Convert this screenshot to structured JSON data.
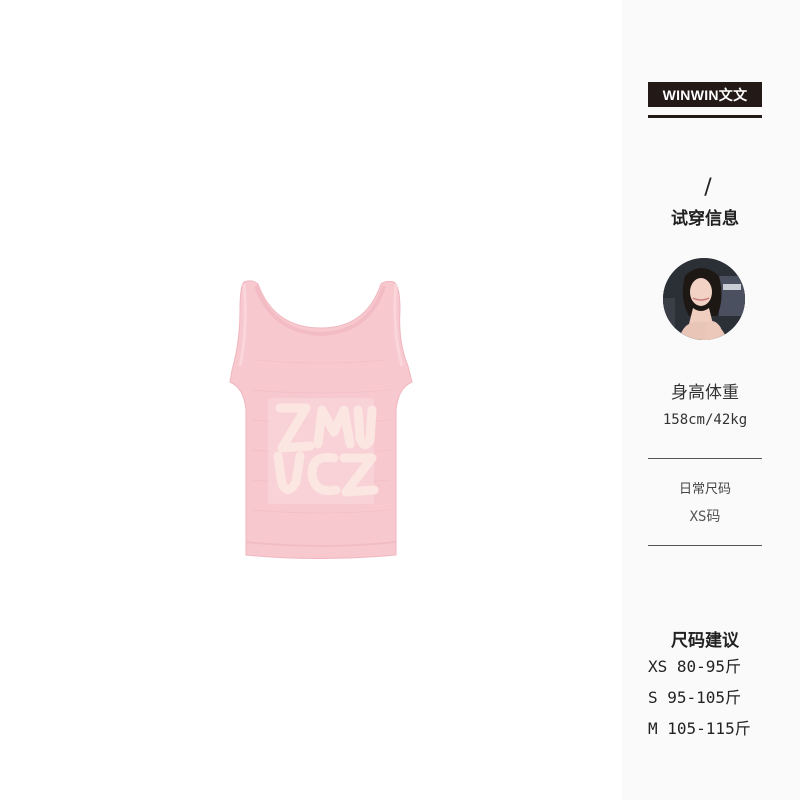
{
  "brand": {
    "name": "WINWIN文文"
  },
  "tryon": {
    "slash": "/",
    "title": "试穿信息",
    "height_weight_label": "身高体重",
    "height_weight_value": "158cm/42kg",
    "usual_size_label": "日常尺码",
    "usual_size_value": "XS码"
  },
  "size_recommendation": {
    "title": "尺码建议",
    "items": [
      "XS 80-95斤",
      "S 95-105斤",
      "M 105-115斤"
    ]
  },
  "product": {
    "logo_text": "ZMUZ"
  },
  "colors": {
    "product": "#f7c9cf",
    "brand_bg": "#231a17",
    "background": "#ffffff"
  }
}
